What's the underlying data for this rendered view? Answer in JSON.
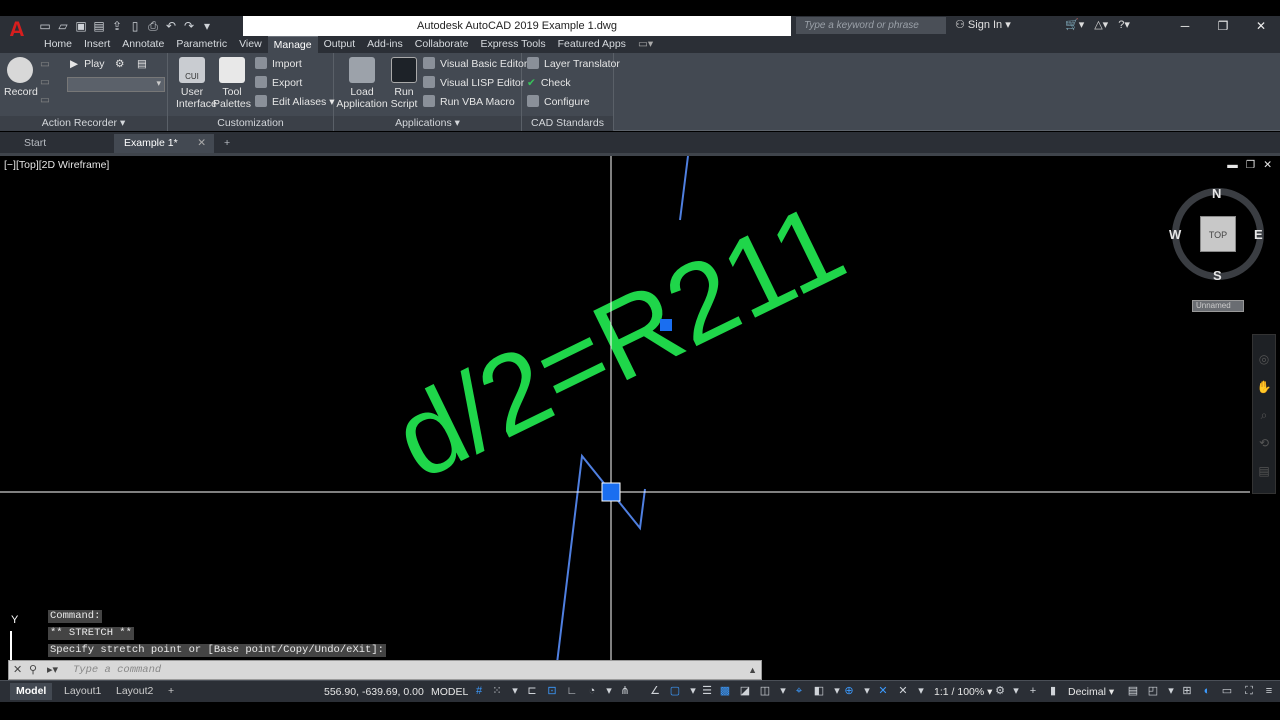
{
  "app": {
    "title": "Autodesk AutoCAD 2019   Example 1.dwg",
    "logo": "A",
    "search_placeholder": "Type a keyword or phrase",
    "sign_in": "Sign In"
  },
  "ribbon_tabs": [
    "Home",
    "Insert",
    "Annotate",
    "Parametric",
    "View",
    "Manage",
    "Output",
    "Add-ins",
    "Collaborate",
    "Express Tools",
    "Featured Apps"
  ],
  "active_tab": "Manage",
  "panels": {
    "action_recorder": {
      "title": "Action Recorder",
      "record": "Record",
      "play": "Play"
    },
    "customization": {
      "title": "Customization",
      "user_interface_1": "User",
      "user_interface_2": "Interface",
      "tool_palettes_1": "Tool",
      "tool_palettes_2": "Palettes",
      "import": "Import",
      "export": "Export",
      "edit_aliases": "Edit Aliases",
      "cui": "CUI"
    },
    "applications": {
      "title": "Applications",
      "load_app_1": "Load",
      "load_app_2": "Application",
      "run_script_1": "Run",
      "run_script_2": "Script",
      "vb_editor": "Visual Basic Editor",
      "lisp_editor": "Visual LISP Editor",
      "run_vba": "Run VBA Macro"
    },
    "cad_standards": {
      "title": "CAD Standards",
      "layer_translator": "Layer Translator",
      "check": "Check",
      "configure": "Configure"
    }
  },
  "doc_tabs": [
    "Start",
    "Example 1*"
  ],
  "viewport": {
    "label": "[−][Top][2D Wireframe]",
    "text_entity": "d/2=R211",
    "text_color": "#1fd64a",
    "viewcube": {
      "n": "N",
      "s": "S",
      "e": "E",
      "w": "W",
      "face": "TOP",
      "ucs": "Unnamed"
    },
    "ucs_y": "Y"
  },
  "command_history": [
    "Command:",
    "** STRETCH **",
    "Specify stretch point or [Base point/Copy/Undo/eXit]:"
  ],
  "command_placeholder": "Type a command",
  "layout_tabs": [
    "Model",
    "Layout1",
    "Layout2"
  ],
  "status": {
    "coords": "556.90, -639.69, 0.00",
    "model": "MODEL",
    "scale": "1:1 / 100%",
    "units": "Decimal"
  }
}
